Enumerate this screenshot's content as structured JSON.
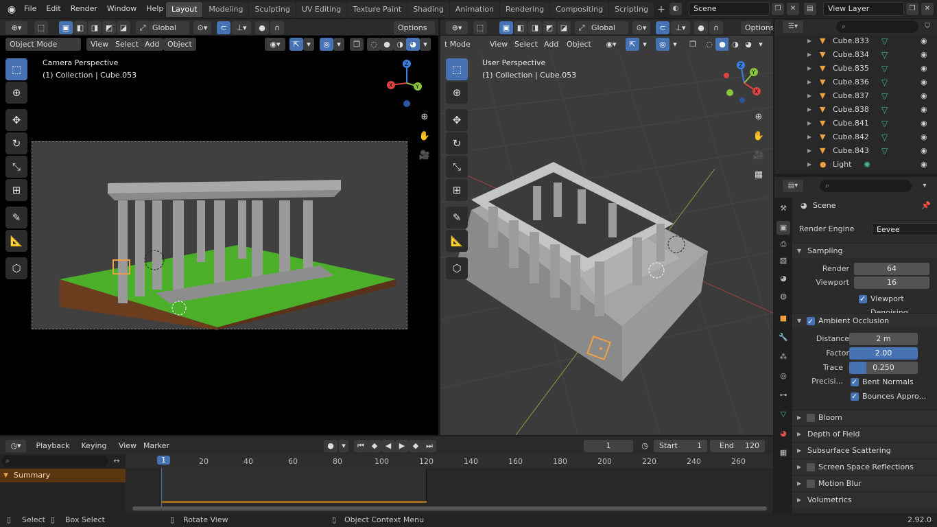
{
  "topbar": {
    "menus": [
      "File",
      "Edit",
      "Render",
      "Window",
      "Help"
    ],
    "workspaces": [
      "Layout",
      "Modeling",
      "Sculpting",
      "UV Editing",
      "Texture Paint",
      "Shading",
      "Animation",
      "Rendering",
      "Compositing",
      "Scripting"
    ],
    "active_workspace": "Layout",
    "scene": "Scene",
    "view_layer": "View Layer"
  },
  "left_viewport": {
    "transform_orientation": "Global",
    "options_label": "Options",
    "mode": "Object Mode",
    "header_menus": [
      "View",
      "Select",
      "Add",
      "Object"
    ],
    "perspective_label": "Camera Perspective",
    "collection_label": "(1) Collection | Cube.053"
  },
  "right_viewport": {
    "transform_orientation": "Global",
    "options_label": "Options",
    "mode": "t Mode",
    "header_menus": [
      "View",
      "Select",
      "Add",
      "Object"
    ],
    "perspective_label": "User Perspective",
    "collection_label": "(1) Collection | Cube.053"
  },
  "outliner": {
    "items": [
      {
        "name": "Cube.833"
      },
      {
        "name": "Cube.834"
      },
      {
        "name": "Cube.835"
      },
      {
        "name": "Cube.836"
      },
      {
        "name": "Cube.837"
      },
      {
        "name": "Cube.838"
      },
      {
        "name": "Cube.841"
      },
      {
        "name": "Cube.842"
      },
      {
        "name": "Cube.843"
      },
      {
        "name": "Light"
      }
    ]
  },
  "properties": {
    "context": "Scene",
    "render_engine_label": "Render Engine",
    "render_engine": "Eevee",
    "sampling": {
      "title": "Sampling",
      "render_label": "Render",
      "render": "64",
      "viewport_label": "Viewport",
      "viewport": "16",
      "denoise_label": "Viewport Denoising"
    },
    "ao": {
      "title": "Ambient Occlusion",
      "distance_label": "Distance",
      "distance": "2 m",
      "factor_label": "Factor",
      "factor": "2.00",
      "trace_label": "Trace Precisi...",
      "trace": "0.250",
      "bent_label": "Bent Normals",
      "bounces_label": "Bounces Appro..."
    },
    "sections": {
      "bloom": "Bloom",
      "dof": "Depth of Field",
      "sss": "Subsurface Scattering",
      "ssr": "Screen Space Reflections",
      "motion_blur": "Motion Blur",
      "volumetrics": "Volumetrics"
    }
  },
  "timeline": {
    "menus": [
      "Playback",
      "Keying",
      "View",
      "Marker"
    ],
    "current_frame": "1",
    "start_label": "Start",
    "start": "1",
    "end_label": "End",
    "end": "120",
    "summary_label": "Summary",
    "ruler": [
      "1",
      "20",
      "40",
      "60",
      "80",
      "100",
      "120",
      "140",
      "160",
      "180",
      "200",
      "220",
      "240",
      "260"
    ]
  },
  "statusbar": {
    "select": "Select",
    "box_select": "Box Select",
    "rotate_view": "Rotate View",
    "context_menu": "Object Context Menu",
    "version": "2.92.0"
  },
  "colors": {
    "accent": "#4772b3",
    "object_orange": "#f0a040",
    "mesh_green": "#46c08a",
    "grass": "#4caf2a"
  }
}
